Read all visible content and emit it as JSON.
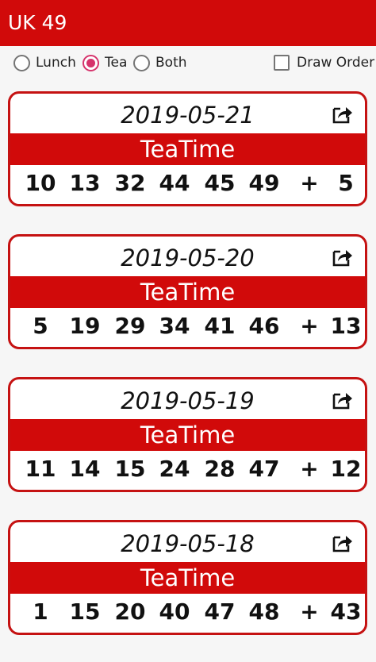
{
  "app": {
    "title": "UK 49"
  },
  "options": {
    "lunch_label": "Lunch",
    "tea_label": "Tea",
    "both_label": "Both",
    "selected": "Tea",
    "draw_order_label": "Draw Order",
    "draw_order_checked": false
  },
  "draws": [
    {
      "date": "2019-05-21",
      "label": "TeaTime",
      "numbers": [
        "10",
        "13",
        "32",
        "44",
        "45",
        "49"
      ],
      "plus": "+",
      "bonus": "5"
    },
    {
      "date": "2019-05-20",
      "label": "TeaTime",
      "numbers": [
        "5",
        "19",
        "29",
        "34",
        "41",
        "46"
      ],
      "plus": "+",
      "bonus": "13"
    },
    {
      "date": "2019-05-19",
      "label": "TeaTime",
      "numbers": [
        "11",
        "14",
        "15",
        "24",
        "28",
        "47"
      ],
      "plus": "+",
      "bonus": "12"
    },
    {
      "date": "2019-05-18",
      "label": "TeaTime",
      "numbers": [
        "1",
        "15",
        "20",
        "40",
        "47",
        "48"
      ],
      "plus": "+",
      "bonus": "43"
    }
  ],
  "icons": {
    "share": "share-icon"
  },
  "colors": {
    "brand_red": "#d10a0a",
    "accent_pink": "#d6336c"
  }
}
